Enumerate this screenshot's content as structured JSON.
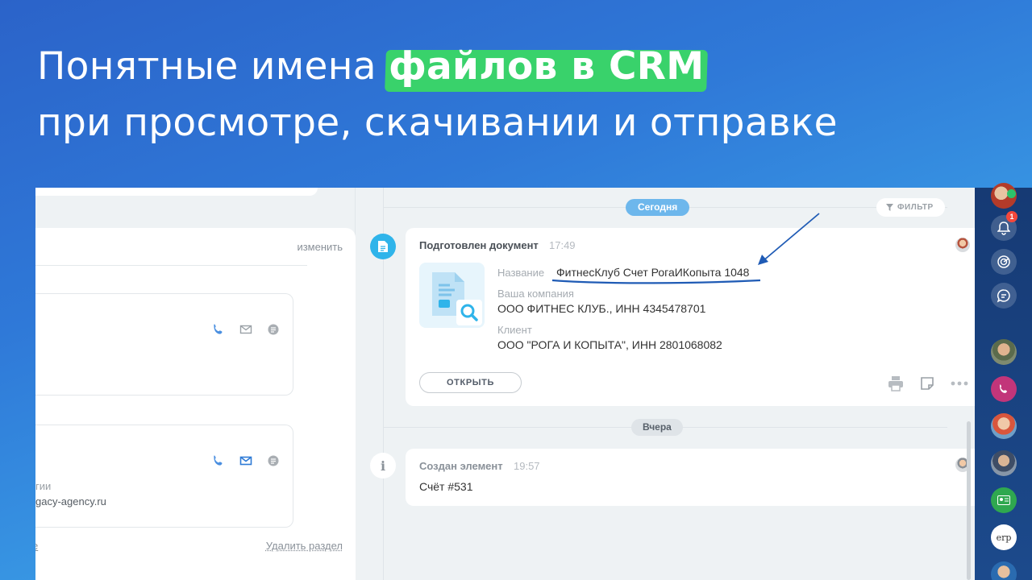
{
  "headline": {
    "line1_prefix": "Понятные имена ",
    "line1_accent": "файлов в CRM",
    "line2": "при просмотре, скачивании и отправке"
  },
  "left_panel": {
    "edit_label": "изменить",
    "card2_line1": "гии",
    "card2_link": "gacy-agency.ru",
    "footer_left": "е",
    "delete_label": "Удалить раздел"
  },
  "timeline": {
    "today_label": "Сегодня",
    "yesterday_label": "Вчера",
    "filter_label": "ФИЛЬТР",
    "doc_card": {
      "title": "Подготовлен документ",
      "time": "17:49",
      "name_label": "Название",
      "name_value": "ФитнесКлуб Счет РогаИКопыта 1048",
      "company_label": "Ваша компания",
      "company_value": "ООО ФИТНЕС КЛУБ., ИНН 4345478701",
      "client_label": "Клиент",
      "client_value": "ООО \"РОГА И КОПЫТА\", ИНН 2801068082",
      "open_button": "ОТКРЫТЬ"
    },
    "created_card": {
      "title": "Создан элемент",
      "time": "19:57",
      "body": "Счёт #531"
    }
  },
  "right_bar": {
    "notification_count": "1",
    "erp_label": "erp"
  },
  "colors": {
    "accent_green": "#39d26b",
    "today_pill": "#6db7ec",
    "link_underline": "#1f5bb5"
  }
}
